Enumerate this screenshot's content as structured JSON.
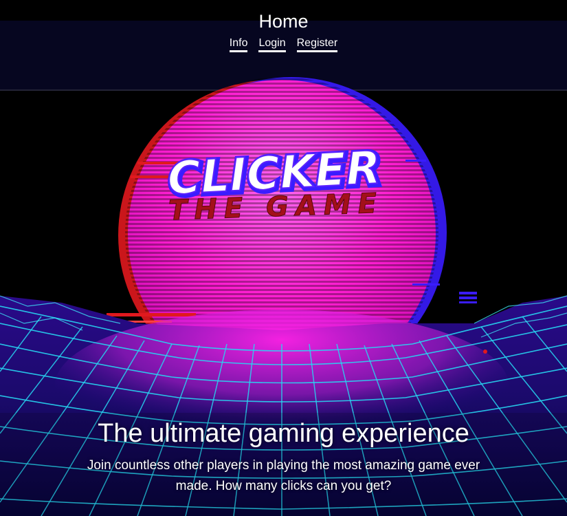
{
  "header": {
    "title": "Home",
    "nav": [
      {
        "label": "Info"
      },
      {
        "label": "Login"
      },
      {
        "label": "Register"
      }
    ]
  },
  "hero": {
    "logo_main": "CLICKER",
    "logo_sub": "THE GAME",
    "heading": "The ultimate gaming experience",
    "subtitle": "Join countless other players in playing the most amazing game ever made. How many clicks can you get?"
  },
  "colors": {
    "background": "#000000",
    "sun": "#ff1fd2",
    "grid": "#27d7f2",
    "glitch_red": "#e0191e",
    "glitch_blue": "#3a1cff",
    "logo_fill": "#ffffff",
    "logo_outline": "#5a22ff",
    "logo_sub": "#a3101a"
  }
}
